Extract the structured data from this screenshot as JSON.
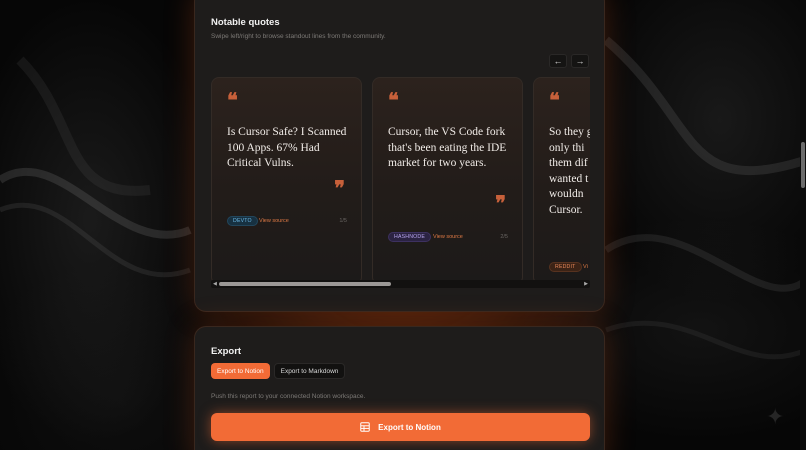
{
  "quotes_section": {
    "title": "Notable quotes",
    "subtitle": "Swipe left/right to browse standout lines from the community.",
    "prev_icon": "←",
    "next_icon": "→",
    "cards": [
      {
        "text": "Is Cursor Safe? I Scanned 100 Apps. 67% Had Critical Vulns.",
        "source_badge": "DEVTO",
        "link_label": "View source",
        "index": "1/5"
      },
      {
        "text": "Cursor, the VS Code fork that's been eating the IDE market for two years.",
        "source_badge": "HASHNODE",
        "link_label": "View source",
        "index": "2/5"
      },
      {
        "text": "So they g only thi them dif wanted t I wouldn Cursor.",
        "source_badge": "REDDIT",
        "link_label": "Vi"
      }
    ],
    "open_quote_glyph": "❝",
    "close_quote_glyph": "❞"
  },
  "export_section": {
    "title": "Export",
    "tabs": [
      {
        "label": "Export to Notion",
        "active": true
      },
      {
        "label": "Export to Markdown",
        "active": false
      }
    ],
    "note": "Push this report to your connected Notion workspace.",
    "button_label": "Export to Notion"
  },
  "colors": {
    "accent": "#f26b36",
    "card_bg": "#1e1c1b",
    "page_bg": "#060606"
  }
}
